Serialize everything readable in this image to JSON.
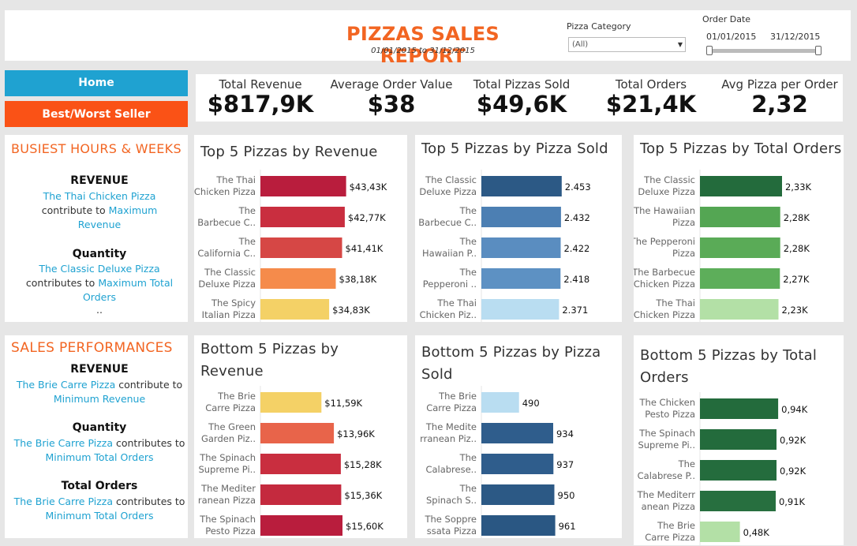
{
  "header": {
    "title": "PIZZAS SALES REPORT",
    "date_range": "01/01/2015 to 31/12/2015",
    "filters": {
      "pizza_category_label": "Pizza Category",
      "pizza_category_value": "(All)",
      "order_date_label": "Order Date",
      "order_date_start": "01/01/2015",
      "order_date_end": "31/12/2015",
      "order_date_selected_fraction": [
        0,
        1
      ]
    }
  },
  "nav": {
    "home_label": "Home",
    "best_worst_label": "Best/Worst Seller",
    "home_color": "#1fa2d1",
    "best_worst_color": "#fa5216"
  },
  "kpis": [
    {
      "label": "Total Revenue",
      "value": "$817,9K"
    },
    {
      "label": "Average Order Value",
      "value": "$38"
    },
    {
      "label": "Total Pizzas Sold",
      "value": "$49,6K"
    },
    {
      "label": "Total Orders",
      "value": "$21,4K"
    },
    {
      "label": "Avg Pizza per Order",
      "value": "2,32"
    }
  ],
  "busiest": {
    "title": "BUSIEST HOURS & WEEKS",
    "revenue_head": "REVENUE",
    "revenue_pizza": "The Thai Chicken Pizza",
    "revenue_mid": "contribute to",
    "revenue_max": "Maximum",
    "revenue_tail": "Revenue",
    "quantity_head": "Quantity",
    "quantity_pizza": "The Classic Deluxe Pizza",
    "quantity_mid": "contributes to",
    "quantity_max": "Maximum Total",
    "quantity_tail": "Orders",
    "ellipsis": ".."
  },
  "sales": {
    "title": "SALES PERFORMANCES",
    "revenue_head": "REVENUE",
    "revenue_pizza": "The Brie Carre Pizza",
    "revenue_mid": "contribute to",
    "revenue_tail": "Minimum Revenue",
    "quantity_head": "Quantity",
    "quantity_pizza": "The Brie Carre Pizza",
    "quantity_mid": "contributes to",
    "quantity_tail": "Minimum Total Orders",
    "orders_head": "Total Orders",
    "orders_pizza": "The Brie Carre Pizza",
    "orders_mid": "contributes to",
    "orders_tail": "Minimum Total Orders"
  },
  "chart_data": [
    {
      "type": "bar",
      "title": "Top 5 Pizzas by Revenue",
      "categories": [
        [
          "The Thai",
          "Chicken Pizza"
        ],
        [
          "The",
          "Barbecue C.."
        ],
        [
          "The",
          "California C.."
        ],
        [
          "The Classic",
          "Deluxe Pizza"
        ],
        [
          "The Spicy",
          "Italian Pizza"
        ]
      ],
      "values": [
        43430,
        42770,
        41410,
        38180,
        34830
      ],
      "labels": [
        "$43,43K",
        "$42,77K",
        "$41,41K",
        "$38,18K",
        "$34,83K"
      ],
      "colors": [
        "#b91d3d",
        "#c92e3f",
        "#d64745",
        "#f58b4b",
        "#f4d166"
      ],
      "xlim": [
        0,
        48000
      ]
    },
    {
      "type": "bar",
      "title": "Top 5 Pizzas by  Pizza Sold",
      "categories": [
        [
          "The Classic",
          "Deluxe Pizza"
        ],
        [
          "The",
          "Barbecue C.."
        ],
        [
          "The",
          "Hawaiian P.."
        ],
        [
          "The",
          "Pepperoni .."
        ],
        [
          "The Thai",
          "Chicken Piz.."
        ]
      ],
      "values": [
        2453,
        2432,
        2422,
        2418,
        2371
      ],
      "labels": [
        "2.453",
        "2.432",
        "2.422",
        "2.418",
        "2.371"
      ],
      "colors": [
        "#2c5985",
        "#4c7fb3",
        "#5a8dc0",
        "#5d91c3",
        "#b9ddf1"
      ],
      "xlim": [
        0,
        2700
      ]
    },
    {
      "type": "bar",
      "title": "Top 5 Pizzas by  Total Orders",
      "categories": [
        [
          "The Classic",
          "Deluxe Pizza"
        ],
        [
          "The Hawaiian",
          "Pizza"
        ],
        [
          "The Pepperoni",
          "Pizza"
        ],
        [
          "The Barbecue",
          "Chicken Pizza"
        ],
        [
          "The Thai",
          "Chicken Pizza"
        ]
      ],
      "values": [
        2330,
        2280,
        2280,
        2270,
        2230
      ],
      "labels": [
        "2,33K",
        "2,28K",
        "2,28K",
        "2,27K",
        "2,23K"
      ],
      "colors": [
        "#236b3c",
        "#54a653",
        "#5aab57",
        "#5dae5a",
        "#b3e0a6"
      ],
      "xlim": [
        0,
        2600
      ]
    },
    {
      "type": "bar",
      "title": "Bottom 5 Pizzas by Revenue",
      "categories": [
        [
          "The Brie",
          "Carre Pizza"
        ],
        [
          "The Green",
          "Garden Piz.."
        ],
        [
          "The Spinach",
          "Supreme Pi.."
        ],
        [
          "The Mediter",
          "ranean Pizza"
        ],
        [
          "The Spinach",
          "Pesto Pizza"
        ]
      ],
      "values": [
        11590,
        13960,
        15280,
        15360,
        15600
      ],
      "labels": [
        "$11,59K",
        "$13,96K",
        "$15,28K",
        "$15,36K",
        "$15,60K"
      ],
      "colors": [
        "#f4d166",
        "#e8644a",
        "#c92e3f",
        "#c42a3e",
        "#b91d3d"
      ],
      "xlim": [
        0,
        18000
      ]
    },
    {
      "type": "bar",
      "title": "Bottom 5 Pizzas by  Pizza Sold",
      "categories": [
        [
          "The Brie",
          "Carre Pizza"
        ],
        [
          "The Medite",
          "rranean Piz.."
        ],
        [
          "The",
          "Calabrese.."
        ],
        [
          "The",
          "Spinach S.."
        ],
        [
          "The Soppre",
          "ssata Pizza"
        ]
      ],
      "values": [
        490,
        934,
        937,
        950,
        961
      ],
      "labels": [
        "490",
        "934",
        "937",
        "950",
        "961"
      ],
      "colors": [
        "#b9ddf1",
        "#2f5d8c",
        "#2f5d8c",
        "#2c5985",
        "#2a5783"
      ],
      "xlim": [
        0,
        1150
      ]
    },
    {
      "type": "bar",
      "title": "Bottom 5 Pizzas by  Total Orders",
      "categories": [
        [
          "The Chicken",
          "Pesto Pizza"
        ],
        [
          "The Spinach",
          "Supreme Pi.."
        ],
        [
          "The",
          "Calabrese P.."
        ],
        [
          "The Mediterr",
          "anean Pizza"
        ],
        [
          "The Brie",
          "Carre Pizza"
        ]
      ],
      "values": [
        940,
        920,
        920,
        910,
        480
      ],
      "labels": [
        "0,94K",
        "0,92K",
        "0,92K",
        "0,91K",
        "0,48K"
      ],
      "colors": [
        "#236b3c",
        "#236b3c",
        "#246c3d",
        "#276f3f",
        "#b3e0a6"
      ],
      "xlim": [
        0,
        1100
      ]
    }
  ]
}
